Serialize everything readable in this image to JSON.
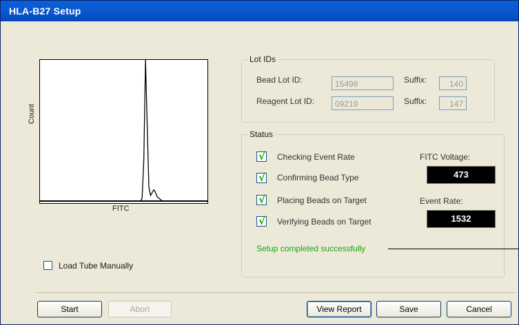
{
  "window": {
    "title": "HLA-B27 Setup"
  },
  "histogram": {
    "y_label": "Count",
    "x_label": "FITC",
    "chart_data": {
      "type": "line",
      "x": [
        0,
        60,
        61,
        62,
        63,
        64,
        65,
        66,
        67,
        68,
        69,
        70,
        71,
        72,
        73,
        74,
        75,
        76,
        77,
        100
      ],
      "y": [
        0,
        0,
        2,
        30,
        100,
        55,
        10,
        4,
        6,
        8,
        6,
        3,
        2,
        1,
        0,
        0,
        0,
        0,
        0,
        0
      ]
    }
  },
  "lot_ids": {
    "legend": "Lot IDs",
    "bead_label": "Bead Lot ID:",
    "bead_value": "15498",
    "bead_suffix_label": "Suffix:",
    "bead_suffix_value": "140",
    "reagent_label": "Reagent Lot ID:",
    "reagent_value": "09219",
    "reagent_suffix_label": "Suffix:",
    "reagent_suffix_value": "147"
  },
  "status": {
    "legend": "Status",
    "steps": [
      {
        "label": "Checking Event Rate",
        "check": "√"
      },
      {
        "label": "Confirming Bead Type",
        "check": "√"
      },
      {
        "label": "Placing Beads on Target",
        "check": "√"
      },
      {
        "label": "Verifying Beads on Target",
        "check": "√"
      }
    ],
    "fitc_voltage_label": "FITC Voltage:",
    "fitc_voltage_value": "473",
    "event_rate_label": "Event Rate:",
    "event_rate_value": "1532",
    "message": "Setup completed successfully",
    "message_color": "#18a218"
  },
  "load_tube_label": "Load Tube Manually",
  "buttons": {
    "start": "Start",
    "abort": "Abort",
    "view_report": "View Report",
    "save": "Save",
    "cancel": "Cancel"
  }
}
